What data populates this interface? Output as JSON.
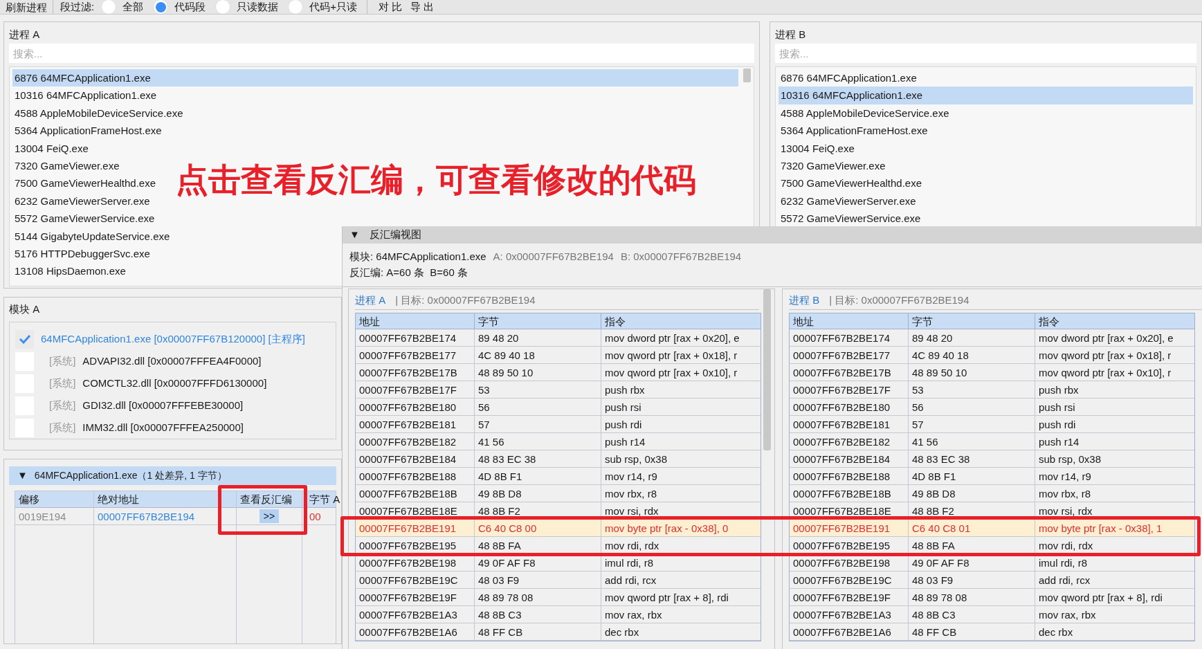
{
  "toolbar": {
    "refresh_button": "刷新进程",
    "filter_label": "段过滤:",
    "filters": [
      {
        "label": "全部",
        "selected": false
      },
      {
        "label": "代码段",
        "selected": true
      },
      {
        "label": "只读数据",
        "selected": false
      },
      {
        "label": "代码+只读",
        "selected": false
      }
    ],
    "actions": [
      "对 比",
      "导 出"
    ]
  },
  "process_a": {
    "title": "进程 A",
    "search": {
      "placeholder": "搜索..."
    },
    "items": [
      {
        "label": "6876 64MFCApplication1.exe",
        "selected": true
      },
      {
        "label": "10316 64MFCApplication1.exe",
        "selected": false
      },
      {
        "label": "4588 AppleMobileDeviceService.exe",
        "selected": false
      },
      {
        "label": "5364 ApplicationFrameHost.exe",
        "selected": false
      },
      {
        "label": "13004 FeiQ.exe",
        "selected": false
      },
      {
        "label": "7320 GameViewer.exe",
        "selected": false
      },
      {
        "label": "7500 GameViewerHealthd.exe",
        "selected": false
      },
      {
        "label": "6232 GameViewerServer.exe",
        "selected": false
      },
      {
        "label": "5572 GameViewerService.exe",
        "selected": false
      },
      {
        "label": "5144 GigabyteUpdateService.exe",
        "selected": false
      },
      {
        "label": "5176 HTTPDebuggerSvc.exe",
        "selected": false
      },
      {
        "label": "13108 HipsDaemon.exe",
        "selected": false
      }
    ]
  },
  "process_b": {
    "title": "进程 B",
    "search": {
      "placeholder": "搜索..."
    },
    "items": [
      {
        "label": "6876 64MFCApplication1.exe",
        "selected": false
      },
      {
        "label": "10316 64MFCApplication1.exe",
        "selected": true
      },
      {
        "label": "4588 AppleMobileDeviceService.exe",
        "selected": false
      },
      {
        "label": "5364 ApplicationFrameHost.exe",
        "selected": false
      },
      {
        "label": "13004 FeiQ.exe",
        "selected": false
      },
      {
        "label": "7320 GameViewer.exe",
        "selected": false
      },
      {
        "label": "7500 GameViewerHealthd.exe",
        "selected": false
      },
      {
        "label": "6232 GameViewerServer.exe",
        "selected": false
      },
      {
        "label": "5572 GameViewerService.exe",
        "selected": false
      }
    ]
  },
  "annotation": "点击查看反汇编，可查看修改的代码",
  "modules_a": {
    "title": "模块 A",
    "items": [
      {
        "kind": "main",
        "name": "64MFCApplication1.exe [0x00007FF67B120000] [主程序]",
        "checked": true
      },
      {
        "kind": "system",
        "tag": "[系统]",
        "name": "ADVAPI32.dll [0x00007FFFEA4F0000]",
        "checked": false
      },
      {
        "kind": "system",
        "tag": "[系统]",
        "name": "COMCTL32.dll [0x00007FFFD6130000]",
        "checked": false
      },
      {
        "kind": "system",
        "tag": "[系统]",
        "name": "GDI32.dll [0x00007FFFEBE30000]",
        "checked": false
      },
      {
        "kind": "system",
        "tag": "[系统]",
        "name": "IMM32.dll [0x00007FFFEA250000]",
        "checked": false
      }
    ]
  },
  "diff": {
    "expanded": true,
    "arrow": "▼",
    "title": "64MFCApplication1.exe（1 处差异, 1 字节）",
    "columns": [
      "偏移",
      "绝对地址",
      "查看反汇编",
      "字节 A"
    ],
    "rows": [
      {
        "offset": "0019E194",
        "address": "00007FF67B2BE194",
        "button": ">>",
        "byte_a": "00"
      }
    ]
  },
  "disasm": {
    "expanded": true,
    "arrow": "▼",
    "title": "反汇编视图",
    "module": "模块: 64MFCApplication1.exe",
    "addr_a": "A: 0x00007FF67B2BE194",
    "addr_b": "B: 0x00007FF67B2BE194",
    "count": "反汇编: A=60 条  B=60 条",
    "panes": [
      {
        "process": "进程 A",
        "target": "| 目标: 0x00007FF67B2BE194",
        "columns": [
          "地址",
          "字节",
          "指令"
        ],
        "rows": [
          {
            "address": "00007FF67B2BE174",
            "bytes": "89 48 20",
            "instruction": "mov dword ptr [rax + 0x20], e",
            "changed": false
          },
          {
            "address": "00007FF67B2BE177",
            "bytes": "4C 89 40 18",
            "instruction": "mov qword ptr [rax + 0x18], r",
            "changed": false
          },
          {
            "address": "00007FF67B2BE17B",
            "bytes": "48 89 50 10",
            "instruction": "mov qword ptr [rax + 0x10], r",
            "changed": false
          },
          {
            "address": "00007FF67B2BE17F",
            "bytes": "53",
            "instruction": "push rbx",
            "changed": false
          },
          {
            "address": "00007FF67B2BE180",
            "bytes": "56",
            "instruction": "push rsi",
            "changed": false
          },
          {
            "address": "00007FF67B2BE181",
            "bytes": "57",
            "instruction": "push rdi",
            "changed": false
          },
          {
            "address": "00007FF67B2BE182",
            "bytes": "41 56",
            "instruction": "push r14",
            "changed": false
          },
          {
            "address": "00007FF67B2BE184",
            "bytes": "48 83 EC 38",
            "instruction": "sub rsp, 0x38",
            "changed": false
          },
          {
            "address": "00007FF67B2BE188",
            "bytes": "4D 8B F1",
            "instruction": "mov r14, r9",
            "changed": false
          },
          {
            "address": "00007FF67B2BE18B",
            "bytes": "49 8B D8",
            "instruction": "mov rbx, r8",
            "changed": false
          },
          {
            "address": "00007FF67B2BE18E",
            "bytes": "48 8B F2",
            "instruction": "mov rsi, rdx",
            "changed": false
          },
          {
            "address": "00007FF67B2BE191",
            "bytes": "C6 40 C8 00",
            "instruction": "mov byte ptr [rax - 0x38], 0",
            "changed": true
          },
          {
            "address": "00007FF67B2BE195",
            "bytes": "48 8B FA",
            "instruction": "mov rdi, rdx",
            "changed": false
          },
          {
            "address": "00007FF67B2BE198",
            "bytes": "49 0F AF F8",
            "instruction": "imul rdi, r8",
            "changed": false
          },
          {
            "address": "00007FF67B2BE19C",
            "bytes": "48 03 F9",
            "instruction": "add rdi, rcx",
            "changed": false
          },
          {
            "address": "00007FF67B2BE19F",
            "bytes": "48 89 78 08",
            "instruction": "mov qword ptr [rax + 8], rdi",
            "changed": false
          },
          {
            "address": "00007FF67B2BE1A3",
            "bytes": "48 8B C3",
            "instruction": "mov rax, rbx",
            "changed": false
          },
          {
            "address": "00007FF67B2BE1A6",
            "bytes": "48 FF CB",
            "instruction": "dec rbx",
            "changed": false
          }
        ]
      },
      {
        "process": "进程 B",
        "target": "| 目标: 0x00007FF67B2BE194",
        "columns": [
          "地址",
          "字节",
          "指令"
        ],
        "rows": [
          {
            "address": "00007FF67B2BE174",
            "bytes": "89 48 20",
            "instruction": "mov dword ptr [rax + 0x20], e",
            "changed": false
          },
          {
            "address": "00007FF67B2BE177",
            "bytes": "4C 89 40 18",
            "instruction": "mov qword ptr [rax + 0x18], r",
            "changed": false
          },
          {
            "address": "00007FF67B2BE17B",
            "bytes": "48 89 50 10",
            "instruction": "mov qword ptr [rax + 0x10], r",
            "changed": false
          },
          {
            "address": "00007FF67B2BE17F",
            "bytes": "53",
            "instruction": "push rbx",
            "changed": false
          },
          {
            "address": "00007FF67B2BE180",
            "bytes": "56",
            "instruction": "push rsi",
            "changed": false
          },
          {
            "address": "00007FF67B2BE181",
            "bytes": "57",
            "instruction": "push rdi",
            "changed": false
          },
          {
            "address": "00007FF67B2BE182",
            "bytes": "41 56",
            "instruction": "push r14",
            "changed": false
          },
          {
            "address": "00007FF67B2BE184",
            "bytes": "48 83 EC 38",
            "instruction": "sub rsp, 0x38",
            "changed": false
          },
          {
            "address": "00007FF67B2BE188",
            "bytes": "4D 8B F1",
            "instruction": "mov r14, r9",
            "changed": false
          },
          {
            "address": "00007FF67B2BE18B",
            "bytes": "49 8B D8",
            "instruction": "mov rbx, r8",
            "changed": false
          },
          {
            "address": "00007FF67B2BE18E",
            "bytes": "48 8B F2",
            "instruction": "mov rsi, rdx",
            "changed": false
          },
          {
            "address": "00007FF67B2BE191",
            "bytes": "C6 40 C8 01",
            "instruction": "mov byte ptr [rax - 0x38], 1",
            "changed": true
          },
          {
            "address": "00007FF67B2BE195",
            "bytes": "48 8B FA",
            "instruction": "mov rdi, rdx",
            "changed": false
          },
          {
            "address": "00007FF67B2BE198",
            "bytes": "49 0F AF F8",
            "instruction": "imul rdi, r8",
            "changed": false
          },
          {
            "address": "00007FF67B2BE19C",
            "bytes": "48 03 F9",
            "instruction": "add rdi, rcx",
            "changed": false
          },
          {
            "address": "00007FF67B2BE19F",
            "bytes": "48 89 78 08",
            "instruction": "mov qword ptr [rax + 8], rdi",
            "changed": false
          },
          {
            "address": "00007FF67B2BE1A3",
            "bytes": "48 8B C3",
            "instruction": "mov rax, rbx",
            "changed": false
          },
          {
            "address": "00007FF67B2BE1A6",
            "bytes": "48 FF CB",
            "instruction": "dec rbx",
            "changed": false
          }
        ]
      }
    ]
  }
}
